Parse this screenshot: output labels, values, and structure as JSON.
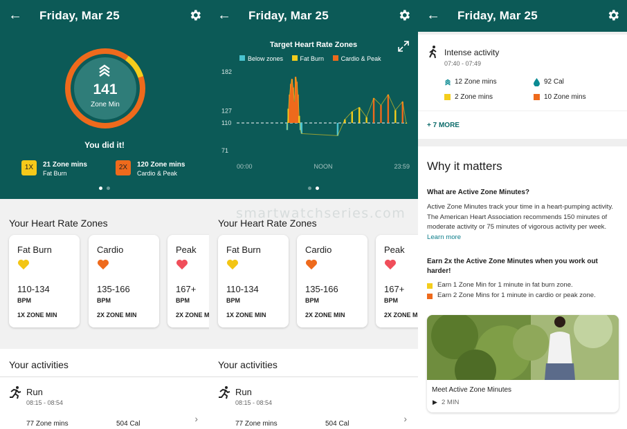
{
  "header": {
    "title": "Friday, Mar 25"
  },
  "panel1": {
    "ring_value": "141",
    "ring_label": "Zone Min",
    "message": "You did it!",
    "stats": [
      {
        "badge": "1X",
        "badge_color": "#f6c91a",
        "value": "21 Zone mins",
        "label": "Fat Burn"
      },
      {
        "badge": "2X",
        "badge_color": "#ee6a1c",
        "value": "120 Zone mins",
        "label": "Cardio & Peak"
      }
    ]
  },
  "panel2": {
    "chart_title": "Target Heart Rate Zones",
    "legend": [
      {
        "label": "Below zones",
        "color": "#49c3cf"
      },
      {
        "label": "Fat Burn",
        "color": "#f4cd1c"
      },
      {
        "label": "Cardio & Peak",
        "color": "#ee6a1c"
      }
    ]
  },
  "chart_data": {
    "type": "line",
    "title": "Target Heart Rate Zones",
    "x_ticks": [
      "00:00",
      "NOON",
      "23:59"
    ],
    "y_ticks": [
      182,
      127,
      110,
      71
    ],
    "ylim": [
      71,
      182
    ],
    "reference_line": 110,
    "series": [
      {
        "name": "Heart rate",
        "x": [
          "07:00",
          "07:10",
          "07:20",
          "07:30",
          "07:40",
          "07:50",
          "08:00",
          "08:10",
          "08:20",
          "08:30",
          "08:40",
          "08:50",
          "09:00",
          "14:00",
          "15:00",
          "16:00",
          "17:00",
          "18:00",
          "19:00",
          "20:00",
          "21:00",
          "22:00",
          "23:00",
          "23:30"
        ],
        "values": [
          100,
          130,
          150,
          165,
          172,
          160,
          140,
          175,
          168,
          150,
          120,
          100,
          95,
          92,
          115,
          126,
          132,
          118,
          145,
          135,
          150,
          128,
          140,
          110
        ]
      }
    ]
  },
  "zones_title": "Your Heart Rate Zones",
  "zones": [
    {
      "name": "Fat Burn",
      "heart_color": "#f3c514",
      "range": "110-134",
      "unit": "BPM",
      "mult": "1X ZONE MIN"
    },
    {
      "name": "Cardio",
      "heart_color": "#ee6a1c",
      "range": "135-166",
      "unit": "BPM",
      "mult": "2X ZONE MIN"
    },
    {
      "name": "Peak",
      "heart_color": "#f04e5a",
      "range": "167+",
      "unit": "BPM",
      "mult": "2X ZONE MIN"
    }
  ],
  "activities_title": "Your activities",
  "activity": {
    "name": "Run",
    "time": "08:15 - 08:54",
    "zone": "77 Zone mins",
    "cal": "504 Cal"
  },
  "watermark": "smartwatchseries.com",
  "panel3": {
    "intense": {
      "name": "Intense activity",
      "time": "07:40 - 07:49",
      "stats": [
        {
          "text": "12 Zone mins",
          "icon": "zone-icon"
        },
        {
          "text": "92 Cal",
          "icon": "drop-icon"
        },
        {
          "text": "2 Zone mins",
          "icon": "yellow-square"
        },
        {
          "text": "10 Zone mins",
          "icon": "orange-square"
        }
      ]
    },
    "more": "+ 7 MORE",
    "why_title": "Why it matters",
    "q1": "What are Active Zone Minutes?",
    "p1": "Active Zone Minutes track your time in a heart-pumping activity. The American Heart Association recommends 150 minutes of moderate activity or 75 minutes of vigorous activity per week.",
    "learn_more": "Learn more",
    "q2": "Earn 2x the Active Zone Minutes when you work out harder!",
    "bullets": [
      {
        "text": "Earn 1 Zone Min for 1 minute in fat burn zone.",
        "color": "#f4cd1c"
      },
      {
        "text": "Earn 2 Zone Mins for 1 minute in cardio or peak zone.",
        "color": "#ee6a1c"
      }
    ],
    "video_title": "Meet Active Zone Minutes",
    "video_duration": "2 MIN"
  }
}
